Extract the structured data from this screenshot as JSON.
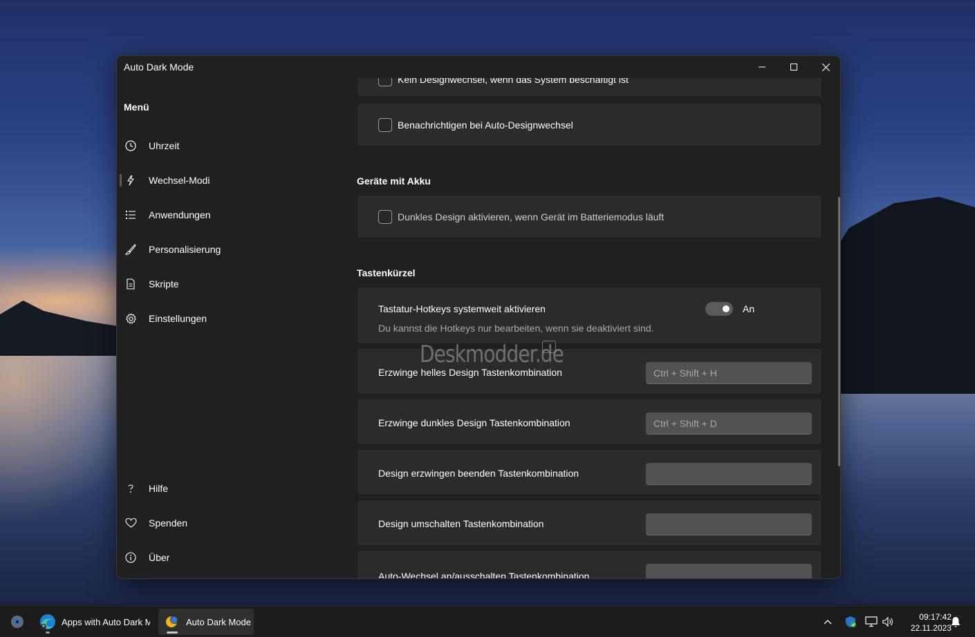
{
  "window": {
    "title": "Auto Dark Mode"
  },
  "sidebar": {
    "heading": "Menü",
    "items": [
      {
        "label": "Uhrzeit",
        "icon": "clock-icon"
      },
      {
        "label": "Wechsel-Modi",
        "icon": "lightning-icon",
        "selected": true
      },
      {
        "label": "Anwendungen",
        "icon": "list-icon"
      },
      {
        "label": "Personalisierung",
        "icon": "brush-icon"
      },
      {
        "label": "Skripte",
        "icon": "document-icon"
      },
      {
        "label": "Einstellungen",
        "icon": "gear-icon"
      }
    ],
    "footer_items": [
      {
        "label": "Hilfe",
        "icon": "question-icon"
      },
      {
        "label": "Spenden",
        "icon": "heart-icon"
      },
      {
        "label": "Über",
        "icon": "info-icon"
      }
    ]
  },
  "content": {
    "top_options": [
      {
        "label": "Kein Designwechsel, wenn das System beschäftigt ist",
        "checked": false
      },
      {
        "label": "Benachrichtigen bei Auto-Designwechsel",
        "checked": false
      }
    ],
    "battery": {
      "title": "Geräte mit Akku",
      "option": {
        "label": "Dunkles Design aktivieren, wenn Gerät im Batteriemodus läuft",
        "checked": false
      }
    },
    "hotkeys": {
      "title": "Tastenkürzel",
      "toggle_label": "Tastatur-Hotkeys systemweit aktivieren",
      "toggle_state": "An",
      "toggle_on": true,
      "toggle_desc": "Du kannst die Hotkeys nur bearbeiten, wenn sie deaktiviert sind.",
      "rows": [
        {
          "label": "Erzwinge helles Design Tastenkombination",
          "value": "Ctrl + Shift + H"
        },
        {
          "label": "Erzwinge dunkles Design Tastenkombination",
          "value": "Ctrl + Shift + D"
        },
        {
          "label": "Design erzwingen beenden Tastenkombination",
          "value": ""
        },
        {
          "label": "Design umschalten Tastenkombination",
          "value": ""
        },
        {
          "label": "Auto-Wechsel an/ausschalten Tastenkombination",
          "value": ""
        }
      ]
    }
  },
  "watermark": "Deskmodder.de",
  "taskbar": {
    "items": [
      {
        "label": "Apps with Auto Dark Mo",
        "icon": "edge-icon"
      },
      {
        "label": "Auto Dark Mode",
        "icon": "auto-dark-mode-icon",
        "active": true
      }
    ],
    "clock_time": "09:17:42",
    "clock_date": "22.11.2023"
  },
  "colors": {
    "window_bg": "#202020",
    "card_bg": "#2b2b2b",
    "taskbar_bg": "#1c1c1c"
  }
}
